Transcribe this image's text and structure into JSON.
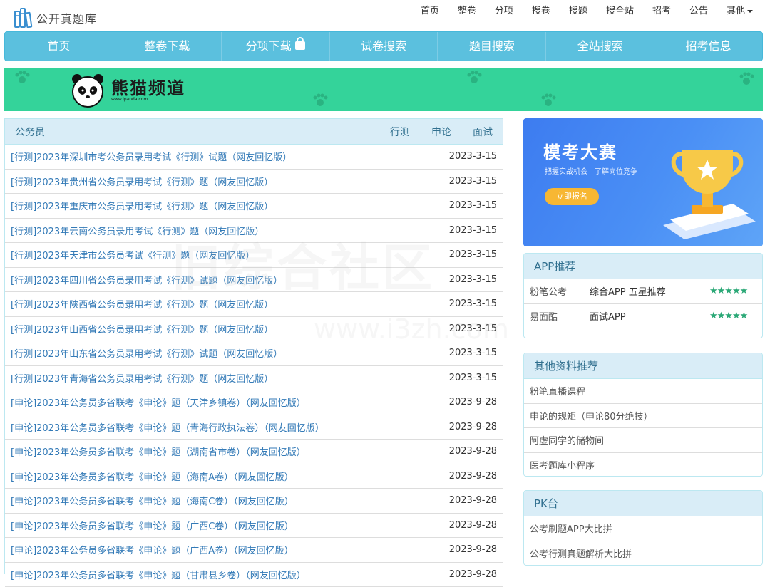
{
  "site": {
    "logo_text": "公开真题库"
  },
  "topnav": [
    "首页",
    "整卷",
    "分项",
    "搜卷",
    "搜题",
    "搜全站",
    "招考",
    "公告",
    "其他"
  ],
  "mainnav": [
    "首页",
    "整卷下载",
    "分项下载",
    "试卷搜索",
    "题目搜索",
    "全站搜索",
    "招考信息"
  ],
  "banner": {
    "title": "熊猫频道",
    "url": "www.ipanda.com",
    "bg_color": "#34d39a"
  },
  "list_panel": {
    "title": "公务员",
    "tabs": [
      "行测",
      "申论",
      "面试"
    ],
    "rows": [
      {
        "title": "[行测]2023年深圳市考公务员录用考试《行测》试题（网友回忆版）",
        "date": "2023-3-15"
      },
      {
        "title": "[行测]2023年贵州省公务员录用考试《行测》题（网友回忆版）",
        "date": "2023-3-15"
      },
      {
        "title": "[行测]2023年重庆市公务员录用考试《行测》题（网友回忆版）",
        "date": "2023-3-15"
      },
      {
        "title": "[行测]2023年云南公务员录用考试《行测》题（网友回忆版）",
        "date": "2023-3-15"
      },
      {
        "title": "[行测]2023年天津市公务员考试《行测》题（网友回忆版）",
        "date": "2023-3-15"
      },
      {
        "title": "[行测]2023年四川省公务员录用考试《行测》试题（网友回忆版）",
        "date": "2023-3-15"
      },
      {
        "title": "[行测]2023年陕西省公务员录用考试《行测》题（网友回忆版）",
        "date": "2023-3-15"
      },
      {
        "title": "[行测]2023年山西省公务员录用考试《行测》题（网友回忆版）",
        "date": "2023-3-15"
      },
      {
        "title": "[行测]2023年山东省公务员录用考试《行测》试题（网友回忆版）",
        "date": "2023-3-15"
      },
      {
        "title": "[行测]2023年青海省公务员录用考试《行测》题（网友回忆版）",
        "date": "2023-3-15"
      },
      {
        "title": "[申论]2023年公务员多省联考《申论》题（天津乡镇卷）（网友回忆版）",
        "date": "2023-9-28"
      },
      {
        "title": "[申论]2023年公务员多省联考《申论》题（青海行政执法卷）（网友回忆版）",
        "date": "2023-9-28"
      },
      {
        "title": "[申论]2023年公务员多省联考《申论》题（湖南省市卷）（网友回忆版）",
        "date": "2023-9-28"
      },
      {
        "title": "[申论]2023年公务员多省联考《申论》题（海南A卷）（网友回忆版）",
        "date": "2023-9-28"
      },
      {
        "title": "[申论]2023年公务员多省联考《申论》题（海南C卷）（网友回忆版）",
        "date": "2023-9-28"
      },
      {
        "title": "[申论]2023年公务员多省联考《申论》题（广西C卷）（网友回忆版）",
        "date": "2023-9-28"
      },
      {
        "title": "[申论]2023年公务员多省联考《申论》题（广西A卷）（网友回忆版）",
        "date": "2023-9-28"
      },
      {
        "title": "[申论]2023年公务员多省联考《申论》题（甘肃县乡卷）（网友回忆版）",
        "date": "2023-9-28"
      }
    ]
  },
  "promo": {
    "title": "模考大赛",
    "subtitle": "把握实战机会　了解岗位竞争",
    "button": "立即报名"
  },
  "app_panel": {
    "title": "APP推荐",
    "items": [
      {
        "name": "粉笔公考",
        "desc": "综合APP 五星推荐",
        "stars": "★★★★★"
      },
      {
        "name": "易面酷",
        "desc": "面试APP",
        "stars": "★★★★★"
      }
    ]
  },
  "other_panel": {
    "title": "其他资料推荐",
    "items": [
      "粉笔直播课程",
      "申论的规矩（申论80分绝技）",
      "阿虚同学的储物间",
      "医考题库小程序"
    ]
  },
  "pk_panel": {
    "title": "PK台",
    "items": [
      "公考刷题APP大比拼",
      "公考行测真题解析大比拼"
    ]
  },
  "watermark": {
    "main": "旧综合社区",
    "url": "www.i3zh.com"
  }
}
